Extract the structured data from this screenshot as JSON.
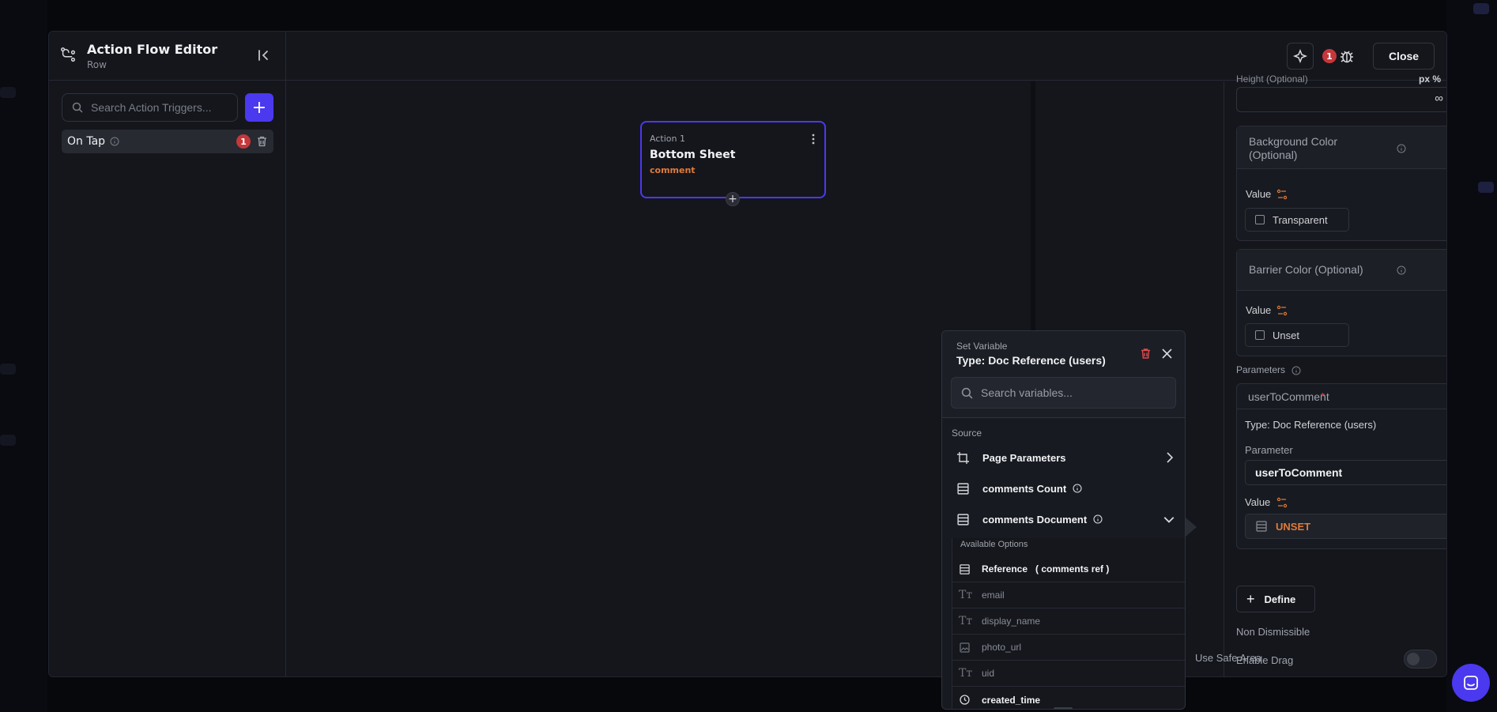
{
  "editor": {
    "title": "Action Flow Editor",
    "subtitle": "Row",
    "search_placeholder": "Search Action Triggers...",
    "add_label": "+",
    "close_label": "Close",
    "issue_count": "1"
  },
  "triggers": [
    {
      "label": "On Tap",
      "count": "1"
    }
  ],
  "action_card": {
    "label": "Action 1",
    "title": "Bottom Sheet",
    "subtitle": "comment"
  },
  "properties": {
    "height_label": "Height (Optional)",
    "height_suffix": "px %",
    "height_value": "∞",
    "background_color": {
      "title": "Background Color (Optional)",
      "value_label": "Value",
      "value": "Transparent"
    },
    "barrier_color": {
      "title": "Barrier Color (Optional)",
      "value_label": "Value",
      "value": "Unset"
    },
    "parameters_label": "Parameters",
    "parameter_name": "userToComment",
    "required_mark": "*",
    "type_label": "Type: Doc Reference (users)",
    "parameter_label": "Parameter",
    "parameter_value": "userToComment",
    "value_label": "Value",
    "value": "UNSET",
    "define_label": "Define",
    "toggles": [
      {
        "label": "Non Dismissible",
        "on": false
      },
      {
        "label": "Enable Drag",
        "on": false
      },
      {
        "label": "Use Safe Area",
        "on": false
      }
    ]
  },
  "set_variable": {
    "title": "Set Variable",
    "type": "Type: Doc Reference (users)",
    "search_placeholder": "Search variables...",
    "source_label": "Source",
    "sources": [
      {
        "label": "Page Parameters"
      },
      {
        "label": "comments Count"
      },
      {
        "label": "comments Document"
      }
    ],
    "available_label": "Available Options",
    "options": [
      {
        "label": "Reference",
        "suffix": "( comments ref )",
        "icon": "table-icon",
        "bold": true
      },
      {
        "label": "email",
        "icon": "text-icon",
        "bold": false
      },
      {
        "label": "display_name",
        "icon": "text-icon",
        "bold": false
      },
      {
        "label": "photo_url",
        "icon": "image-icon",
        "bold": false
      },
      {
        "label": "uid",
        "icon": "text-icon",
        "bold": false
      },
      {
        "label": "created_time",
        "icon": "clock-icon",
        "bold": true
      }
    ]
  },
  "colors": {
    "accent": "#4B39EF",
    "warning": "#E07A3C",
    "danger": "#C4373B"
  }
}
